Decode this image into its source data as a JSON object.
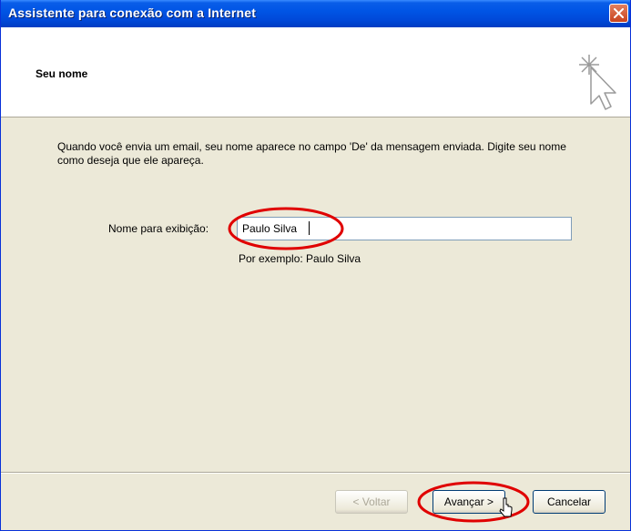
{
  "window": {
    "title": "Assistente para conexão com a Internet",
    "close_icon": "close-icon"
  },
  "header": {
    "title": "Seu nome",
    "icon": "wizard-sparkle-cursor-icon"
  },
  "body": {
    "description": "Quando você envia um email, seu nome aparece no campo 'De' da mensagem enviada. Digite seu nome como deseja que ele apareça.",
    "field_label": "Nome para exibição:",
    "field_value": "Paulo Silva",
    "example": "Por exemplo: Paulo Silva"
  },
  "buttons": {
    "back": "< Voltar",
    "next": "Avançar >",
    "cancel": "Cancelar"
  },
  "colors": {
    "titlebar": "#0055e5",
    "annotation": "#e00000",
    "window_bg": "#ece9d8"
  }
}
